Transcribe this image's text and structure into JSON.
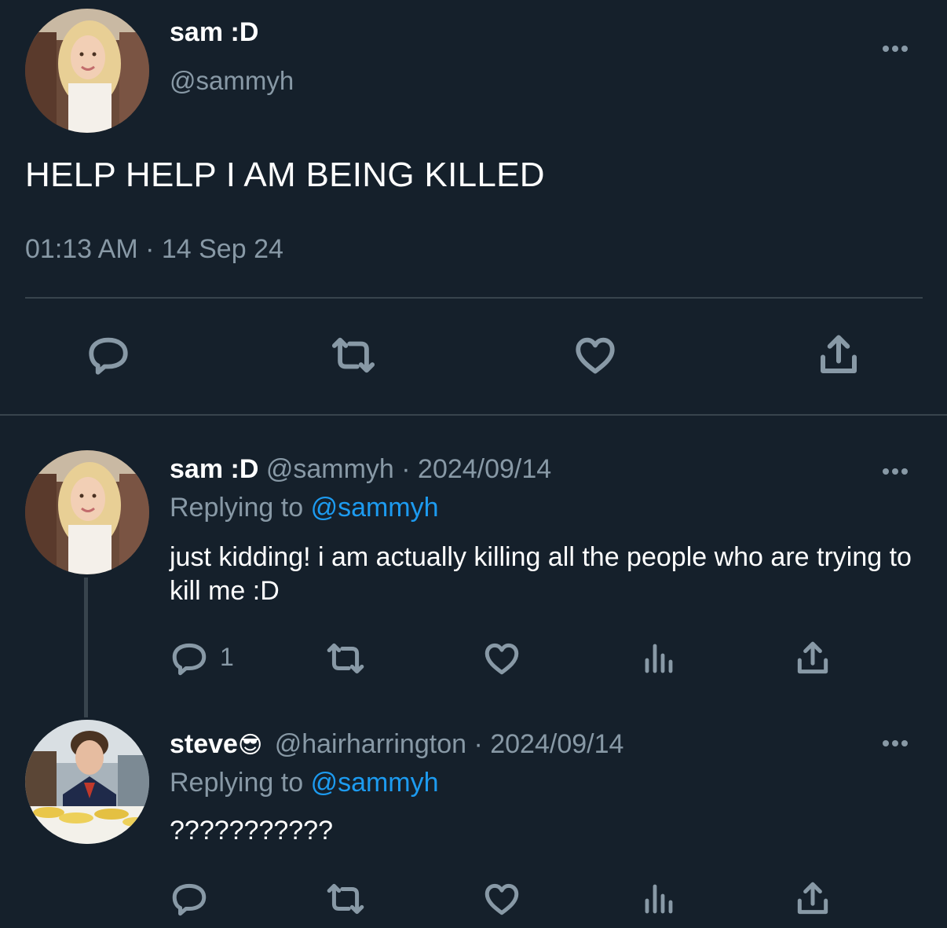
{
  "main_tweet": {
    "display_name": "sam :D",
    "handle": "@sammyh",
    "text": "HELP HELP I AM BEING KILLED",
    "timestamp": "01:13 AM · 14 Sep 24"
  },
  "reply_1": {
    "display_name": "sam :D",
    "handle": "@sammyh",
    "date": "· 2024/09/14",
    "replying_prefix": "Replying to",
    "replying_handle": "@sammyh",
    "text": "just kidding! i am actually killing all the people who are trying to kill me :D",
    "reply_count": "1"
  },
  "reply_2": {
    "display_name": "steve",
    "emoji": "😎",
    "handle": "@hairharrington",
    "date": "· 2024/09/14",
    "replying_prefix": "Replying to",
    "replying_handle": "@sammyh",
    "text": "???????????"
  },
  "icons": {
    "reply": "reply-icon",
    "retweet": "retweet-icon",
    "like": "like-icon",
    "views": "views-icon",
    "share": "share-icon",
    "more": "more-icon"
  },
  "colors": {
    "background": "#15202b",
    "muted": "#8899a6",
    "link": "#1d9bf0",
    "divider": "#38444d"
  }
}
